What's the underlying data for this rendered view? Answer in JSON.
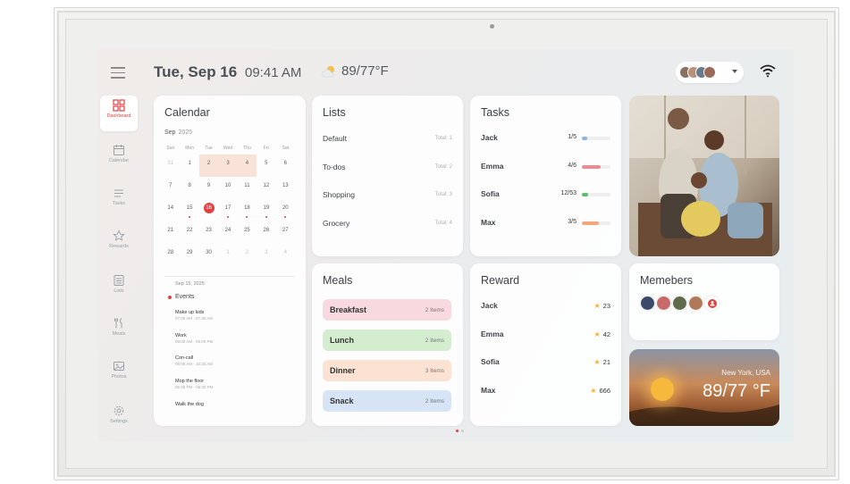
{
  "header": {
    "date": "Tue, Sep 16",
    "time": "09:41 AM",
    "temperature": "89/77°F",
    "weather_icon": "partly-cloudy-icon"
  },
  "sidebar": {
    "items": [
      {
        "label": "Dashboard",
        "icon": "dashboard-icon",
        "active": true
      },
      {
        "label": "Calendar",
        "icon": "calendar-icon"
      },
      {
        "label": "Tasks",
        "icon": "tasks-icon"
      },
      {
        "label": "Rewards",
        "icon": "star-icon"
      },
      {
        "label": "Lists",
        "icon": "list-icon"
      },
      {
        "label": "Meals",
        "icon": "meals-icon"
      },
      {
        "label": "Photos",
        "icon": "photo-icon"
      },
      {
        "label": "Settings",
        "icon": "gear-icon"
      }
    ]
  },
  "calendar": {
    "title": "Calendar",
    "month": "Sep",
    "year": "2025",
    "weekdays": [
      "Sun",
      "Mon",
      "Tue",
      "Wed",
      "Thu",
      "Fri",
      "Sat"
    ],
    "days": [
      {
        "d": "31",
        "m": true
      },
      {
        "d": "1"
      },
      {
        "d": "2",
        "hl": true
      },
      {
        "d": "3",
        "hl": true
      },
      {
        "d": "4",
        "hl": true
      },
      {
        "d": "5"
      },
      {
        "d": "6"
      },
      {
        "d": "7"
      },
      {
        "d": "8"
      },
      {
        "d": "9"
      },
      {
        "d": "10"
      },
      {
        "d": "11"
      },
      {
        "d": "12"
      },
      {
        "d": "13"
      },
      {
        "d": "14"
      },
      {
        "d": "15",
        "dot": true
      },
      {
        "d": "16",
        "today": true
      },
      {
        "d": "17",
        "dot": true
      },
      {
        "d": "18",
        "dot": true
      },
      {
        "d": "19",
        "dot": true
      },
      {
        "d": "20",
        "dot": true
      },
      {
        "d": "21"
      },
      {
        "d": "22"
      },
      {
        "d": "23"
      },
      {
        "d": "24"
      },
      {
        "d": "25"
      },
      {
        "d": "26"
      },
      {
        "d": "27"
      },
      {
        "d": "28"
      },
      {
        "d": "29"
      },
      {
        "d": "30"
      },
      {
        "d": "1",
        "m": true
      },
      {
        "d": "2",
        "m": true
      },
      {
        "d": "3",
        "m": true
      },
      {
        "d": "4",
        "m": true
      }
    ],
    "selected_date": "Sep 15, 2025",
    "events_label": "Events",
    "events": [
      {
        "title": "Make up kids",
        "time": "07:08 AM - 07:30 AM"
      },
      {
        "title": "Work",
        "time": "08:08 AM - 05:00 PM"
      },
      {
        "title": "Con-call",
        "time": "08:08 AM - 10:30 AM"
      },
      {
        "title": "Mop the floor",
        "time": "05:08 PM - 05:30 PM"
      },
      {
        "title": "Walk the dog",
        "time": ""
      }
    ]
  },
  "lists": {
    "title": "Lists",
    "items": [
      {
        "name": "Default",
        "total": "Total: 1"
      },
      {
        "name": "To-dos",
        "total": "Total: 2"
      },
      {
        "name": "Shopping",
        "total": "Total: 3"
      },
      {
        "name": "Grocery",
        "total": "Total: 4"
      }
    ]
  },
  "tasks": {
    "title": "Tasks",
    "items": [
      {
        "name": "Jack",
        "count": "1/5",
        "progress": 0.2,
        "color": "#8fb3e8"
      },
      {
        "name": "Emma",
        "count": "4/6",
        "progress": 0.67,
        "color": "#ef8a94"
      },
      {
        "name": "Sofia",
        "count": "12/53",
        "progress": 0.23,
        "color": "#5cc06a"
      },
      {
        "name": "Max",
        "count": "3/5",
        "progress": 0.6,
        "color": "#f2a77a"
      }
    ]
  },
  "meals": {
    "title": "Meals",
    "items": [
      {
        "name": "Breakfast",
        "count": "2 Items",
        "color": "#f8d9df"
      },
      {
        "name": "Lunch",
        "count": "2 Items",
        "color": "#d5edcf"
      },
      {
        "name": "Dinner",
        "count": "3 Items",
        "color": "#fbe2d2"
      },
      {
        "name": "Snack",
        "count": "2 Items",
        "color": "#d6e4f5"
      }
    ]
  },
  "reward": {
    "title": "Reward",
    "items": [
      {
        "name": "Jack",
        "points": "23"
      },
      {
        "name": "Emma",
        "points": "42"
      },
      {
        "name": "Sofia",
        "points": "21"
      },
      {
        "name": "Max",
        "points": "666"
      }
    ]
  },
  "members": {
    "title": "Memebers",
    "avatars": [
      "#3b4a6b",
      "#c96a6a",
      "#5f6b4a",
      "#b07a5a",
      "#ffffff"
    ]
  },
  "weather_card": {
    "city": "New York, USA",
    "temp": "89/77 °F"
  },
  "colors": {
    "accent": "#e0403f"
  }
}
